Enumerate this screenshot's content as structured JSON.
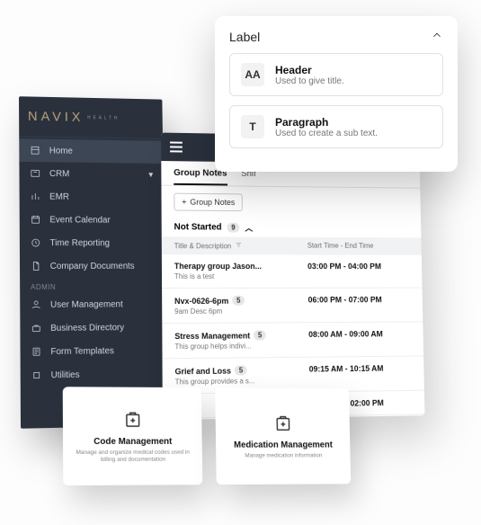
{
  "brand": {
    "name": "NAVIX",
    "sub": "HEALTH"
  },
  "sidebar": {
    "items": [
      {
        "label": "Home",
        "active": true
      },
      {
        "label": "CRM"
      },
      {
        "label": "EMR"
      },
      {
        "label": "Event Calendar"
      },
      {
        "label": "Time Reporting"
      },
      {
        "label": "Company Documents"
      }
    ],
    "admin_label": "ADMIN",
    "admin_items": [
      {
        "label": "User Management"
      },
      {
        "label": "Business Directory"
      },
      {
        "label": "Form Templates"
      },
      {
        "label": "Utilities"
      }
    ]
  },
  "notes": {
    "tabs": [
      {
        "label": "Group Notes",
        "active": true
      },
      {
        "label": "Shif"
      }
    ],
    "button_label": "Group Notes",
    "status_label": "Not Started",
    "status_count": "9",
    "col_title": "Title & Description",
    "col_time": "Start Time - End Time",
    "rows": [
      {
        "title": "Therapy group Jason...",
        "desc": "This is a test",
        "time": "03:00 PM - 04:00 PM",
        "badge": ""
      },
      {
        "title": "Nvx-0626-6pm",
        "desc": "9am Desc 6pm",
        "time": "06:00 PM - 07:00 PM",
        "badge": "5"
      },
      {
        "title": "Stress Management",
        "desc": "This group helps indivi...",
        "time": "08:00 AM - 09:00 AM",
        "badge": "5"
      },
      {
        "title": "Grief and Loss",
        "desc": "This group provides a s...",
        "time": "09:15 AM - 10:15 AM",
        "badge": "5"
      },
      {
        "title": "",
        "desc": "",
        "time": "01:00 PM - 02:00 PM",
        "badge": ""
      }
    ]
  },
  "popover": {
    "title": "Label",
    "options": [
      {
        "glyph": "AA",
        "title": "Header",
        "desc": "Used to give title."
      },
      {
        "glyph": "T",
        "title": "Paragraph",
        "desc": "Used to create a sub text."
      }
    ]
  },
  "cards": [
    {
      "title": "Code Management",
      "desc": "Manage and organize medical codes used in billing and documentation"
    },
    {
      "title": "Medication Management",
      "desc": "Manage medication information"
    }
  ]
}
